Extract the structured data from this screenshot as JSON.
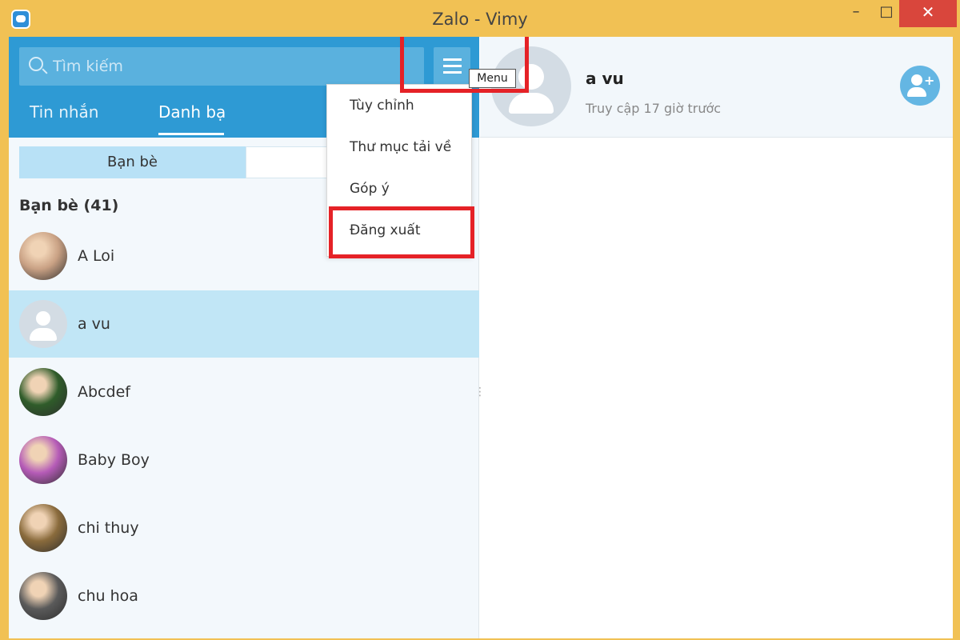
{
  "window": {
    "title": "Zalo - Vimy",
    "minimize": "–",
    "maximize": "□",
    "close": "✕"
  },
  "search": {
    "placeholder": "Tìm kiếm"
  },
  "menu": {
    "tooltip": "Menu",
    "items": [
      "Tùy chỉnh",
      "Thư mục tải về",
      "Góp ý",
      "Đăng xuất"
    ]
  },
  "tabs": [
    "Tin nhắn",
    "Danh bạ"
  ],
  "segments": [
    "Bạn bè",
    ""
  ],
  "section": {
    "title": "Bạn bè (41)"
  },
  "contacts": [
    {
      "name": "A Loi",
      "avatar": "photo-avatar",
      "color": "#c9a184"
    },
    {
      "name": "a vu",
      "avatar": "default-avatar",
      "selected": true
    },
    {
      "name": "Abcdef",
      "avatar": "photo-avatar",
      "color": "#2f5c2a"
    },
    {
      "name": "Baby Boy",
      "avatar": "photo-avatar",
      "color": "#b55bb7"
    },
    {
      "name": "chi thuy",
      "avatar": "photo-avatar",
      "color": "#8a6b3c"
    },
    {
      "name": "chu hoa",
      "avatar": "photo-avatar",
      "color": "#5a5a5a"
    }
  ],
  "profile": {
    "name": "a vu",
    "status": "Truy cập 17 giờ trước",
    "add_friend_icon": "add-friend-icon"
  },
  "colors": {
    "frame": "#f1c154",
    "header_blue": "#2e9ad4",
    "selected": "#c1e6f6",
    "highlight_red": "#e52227"
  }
}
